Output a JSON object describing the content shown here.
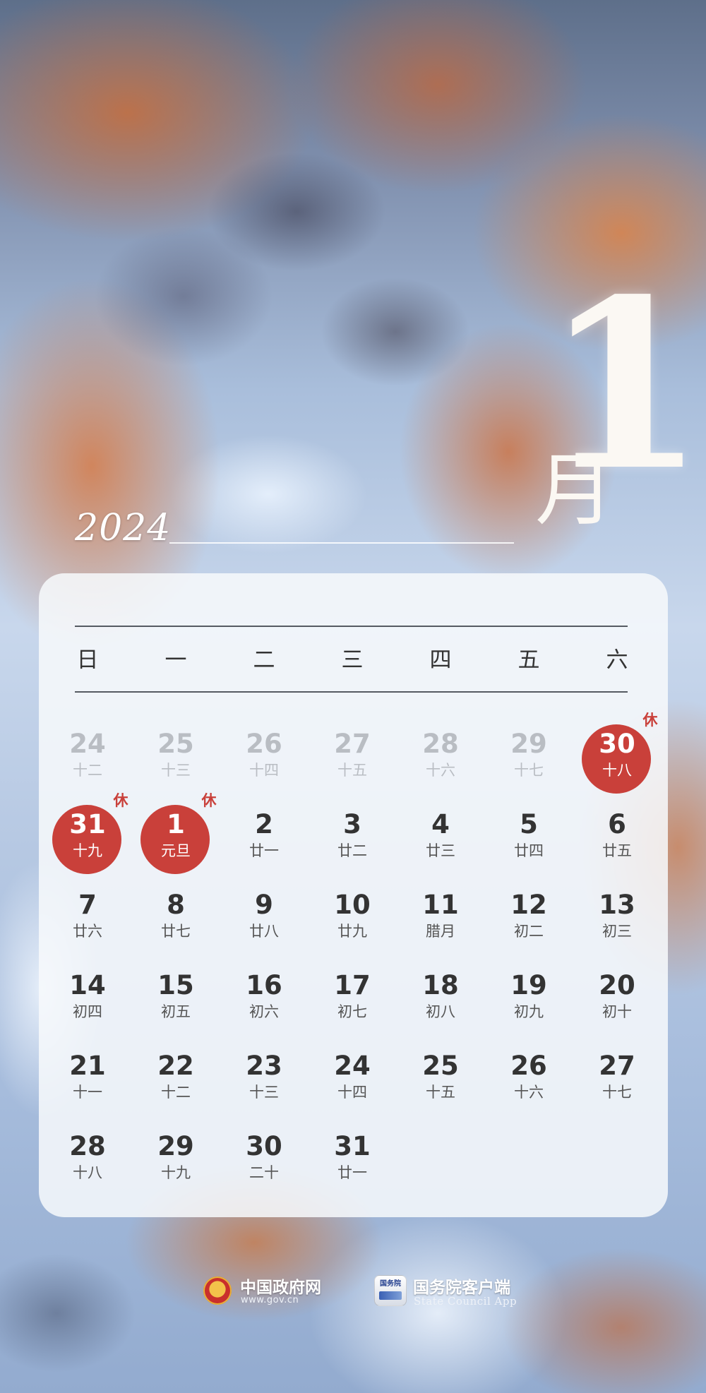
{
  "header": {
    "year": "2024",
    "month_number": "1",
    "month_char": "月"
  },
  "calendar": {
    "weekdays": [
      "日",
      "一",
      "二",
      "三",
      "四",
      "五",
      "六"
    ],
    "rest_label": "休",
    "holiday_color": "#c9403a",
    "weeks": [
      [
        {
          "num": "24",
          "lunar": "十二",
          "faded": true
        },
        {
          "num": "25",
          "lunar": "十三",
          "faded": true
        },
        {
          "num": "26",
          "lunar": "十四",
          "faded": true
        },
        {
          "num": "27",
          "lunar": "十五",
          "faded": true
        },
        {
          "num": "28",
          "lunar": "十六",
          "faded": true
        },
        {
          "num": "29",
          "lunar": "十七",
          "faded": true
        },
        {
          "num": "30",
          "lunar": "十八",
          "holiday": true
        }
      ],
      [
        {
          "num": "31",
          "lunar": "十九",
          "holiday": true
        },
        {
          "num": "1",
          "lunar": "元旦",
          "holiday": true
        },
        {
          "num": "2",
          "lunar": "廿一"
        },
        {
          "num": "3",
          "lunar": "廿二"
        },
        {
          "num": "4",
          "lunar": "廿三"
        },
        {
          "num": "5",
          "lunar": "廿四"
        },
        {
          "num": "6",
          "lunar": "廿五"
        }
      ],
      [
        {
          "num": "7",
          "lunar": "廿六"
        },
        {
          "num": "8",
          "lunar": "廿七"
        },
        {
          "num": "9",
          "lunar": "廿八"
        },
        {
          "num": "10",
          "lunar": "廿九"
        },
        {
          "num": "11",
          "lunar": "腊月"
        },
        {
          "num": "12",
          "lunar": "初二"
        },
        {
          "num": "13",
          "lunar": "初三"
        }
      ],
      [
        {
          "num": "14",
          "lunar": "初四"
        },
        {
          "num": "15",
          "lunar": "初五"
        },
        {
          "num": "16",
          "lunar": "初六"
        },
        {
          "num": "17",
          "lunar": "初七"
        },
        {
          "num": "18",
          "lunar": "初八"
        },
        {
          "num": "19",
          "lunar": "初九"
        },
        {
          "num": "20",
          "lunar": "初十"
        }
      ],
      [
        {
          "num": "21",
          "lunar": "十一"
        },
        {
          "num": "22",
          "lunar": "十二"
        },
        {
          "num": "23",
          "lunar": "十三"
        },
        {
          "num": "24",
          "lunar": "十四"
        },
        {
          "num": "25",
          "lunar": "十五"
        },
        {
          "num": "26",
          "lunar": "十六"
        },
        {
          "num": "27",
          "lunar": "十七"
        }
      ],
      [
        {
          "num": "28",
          "lunar": "十八"
        },
        {
          "num": "29",
          "lunar": "十九"
        },
        {
          "num": "30",
          "lunar": "二十"
        },
        {
          "num": "31",
          "lunar": "廿一"
        }
      ]
    ]
  },
  "footer": {
    "gov_site": {
      "name": "中国政府网",
      "url": "www.gov.cn",
      "icon": "national-emblem-icon"
    },
    "app": {
      "name": "国务院客户端",
      "subtitle": "State Council App",
      "icon": "state-council-app-icon",
      "icon_text": "国务院"
    }
  }
}
